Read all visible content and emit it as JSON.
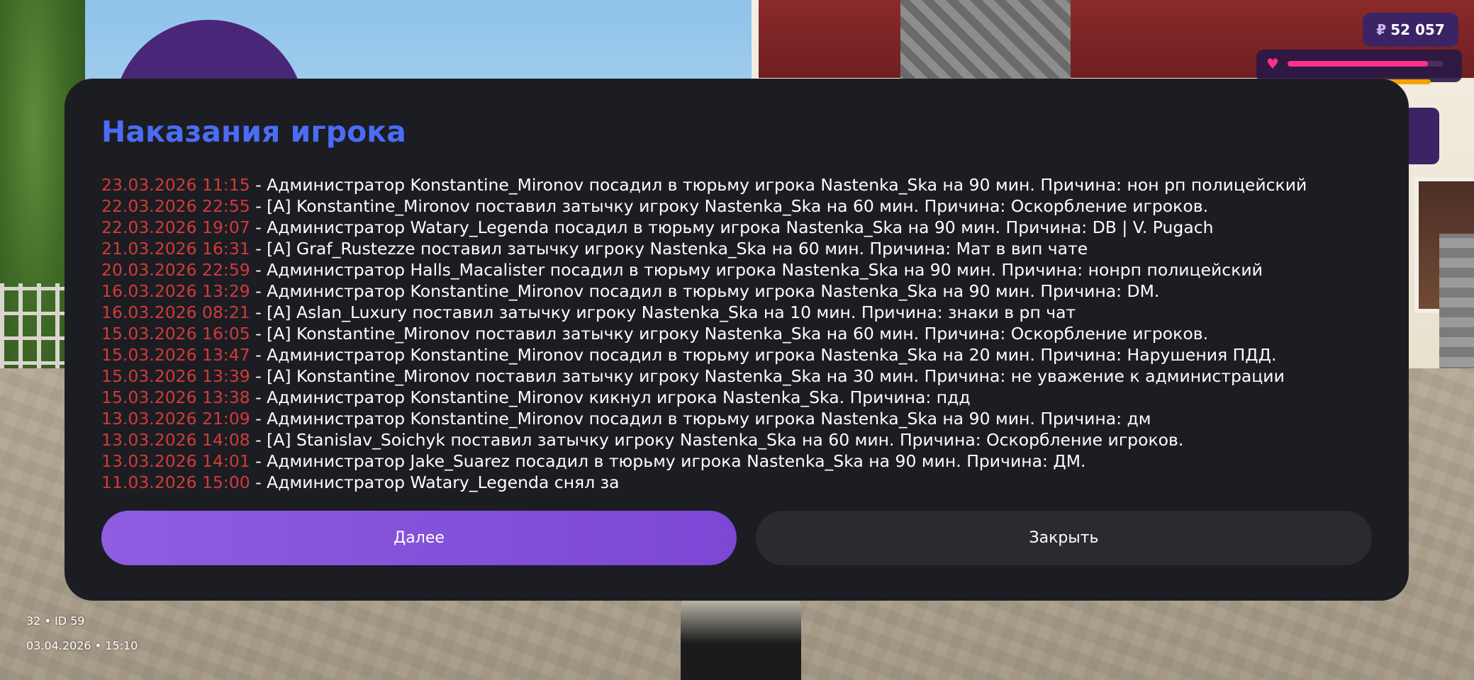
{
  "hud": {
    "currency_symbol": "₽",
    "money": "52 057",
    "health_fraction": 0.9,
    "armor_fraction": 0.9
  },
  "modal": {
    "title": "Наказания игрока",
    "entries": [
      {
        "date": "23.03.2026 11:15",
        "text": " - Администратор Konstantine_Mironov посадил в тюрьму игрока Nastenka_Ska на 90 мин. Причина: нон рп полицейский"
      },
      {
        "date": "22.03.2026 22:55",
        "text": " - [A] Konstantine_Mironov поставил затычку игроку Nastenka_Ska на 60 мин. Причина: Оскорбление игроков."
      },
      {
        "date": "22.03.2026 19:07",
        "text": " - Администратор Watary_Legenda посадил в тюрьму игрока Nastenka_Ska на 90 мин. Причина: DB | V. Pugach"
      },
      {
        "date": "21.03.2026 16:31",
        "text": " - [A] Graf_Rustezze поставил затычку игроку Nastenka_Ska на 60 мин. Причина: Мат в вип чате"
      },
      {
        "date": "20.03.2026 22:59",
        "text": " - Администратор Halls_Macalister посадил в тюрьму игрока Nastenka_Ska на 90 мин. Причина: нонрп полицейский"
      },
      {
        "date": "16.03.2026 13:29",
        "text": " - Администратор Konstantine_Mironov посадил в тюрьму игрока Nastenka_Ska на 90 мин. Причина: DM."
      },
      {
        "date": "16.03.2026 08:21",
        "text": " - [A] Aslan_Luxury поставил затычку игроку Nastenka_Ska на 10 мин. Причина: знаки в рп чат"
      },
      {
        "date": "15.03.2026 16:05",
        "text": " - [A] Konstantine_Mironov поставил затычку игроку Nastenka_Ska на 60 мин. Причина: Оскорбление игроков."
      },
      {
        "date": "15.03.2026 13:47",
        "text": " - Администратор Konstantine_Mironov посадил в тюрьму игрока Nastenka_Ska на 20 мин. Причина: Нарушения ПДД."
      },
      {
        "date": "15.03.2026 13:39",
        "text": " - [A] Konstantine_Mironov поставил затычку игроку Nastenka_Ska на 30 мин. Причина: не уважение к администрации"
      },
      {
        "date": "15.03.2026 13:38",
        "text": " - Администратор Konstantine_Mironov кикнул игрока Nastenka_Ska. Причина: пдд"
      },
      {
        "date": "13.03.2026 21:09",
        "text": " - Администратор Konstantine_Mironov посадил в тюрьму игрока Nastenka_Ska на 90 мин. Причина: дм"
      },
      {
        "date": "13.03.2026 14:08",
        "text": " - [A] Stanislav_Soichyk поставил затычку игроку Nastenka_Ska на 60 мин. Причина: Оскорбление игроков."
      },
      {
        "date": "13.03.2026 14:01",
        "text": " - Администратор Jake_Suarez посадил в тюрьму игрока Nastenka_Ska на 90 мин. Причина: ДМ."
      },
      {
        "date": "11.03.2026 15:00",
        "text": " - Администратор Watary_Legenda снял за"
      }
    ],
    "next_label": "Далее",
    "close_label": "Закрыть"
  },
  "footer": {
    "server_info": "32 • ID 59",
    "datetime": "03.04.2026 • 15:10"
  }
}
